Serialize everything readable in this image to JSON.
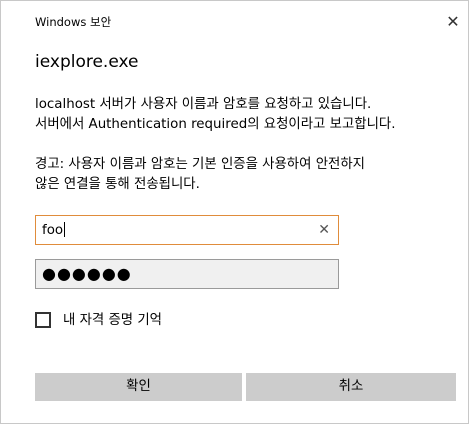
{
  "titlebar": {
    "title": "Windows 보안",
    "close_glyph": "✕"
  },
  "app_name": "iexplore.exe",
  "message_line1": "localhost 서버가 사용자 이름과 암호를 요청하고 있습니다.",
  "message_line2": "서버에서 Authentication required의 요청이라고 보고합니다.",
  "warning_line1": "경고: 사용자 이름과 암호는 기본 인증을 사용하여 안전하지",
  "warning_line2": "않은 연결을 통해 전송됩니다.",
  "username": {
    "value": "foo",
    "clear_glyph": "✕"
  },
  "password": {
    "masked_value": "●●●●●●"
  },
  "remember": {
    "label": "내 자격 증명 기억",
    "checked": false
  },
  "buttons": {
    "ok_label": "확인",
    "cancel_label": "취소"
  },
  "colors": {
    "focus_border": "#e08c3b",
    "button_bg": "#cccccc",
    "footer_bg": "#ffffff"
  },
  "icons": {
    "close": "close-icon",
    "clear": "clear-icon"
  }
}
